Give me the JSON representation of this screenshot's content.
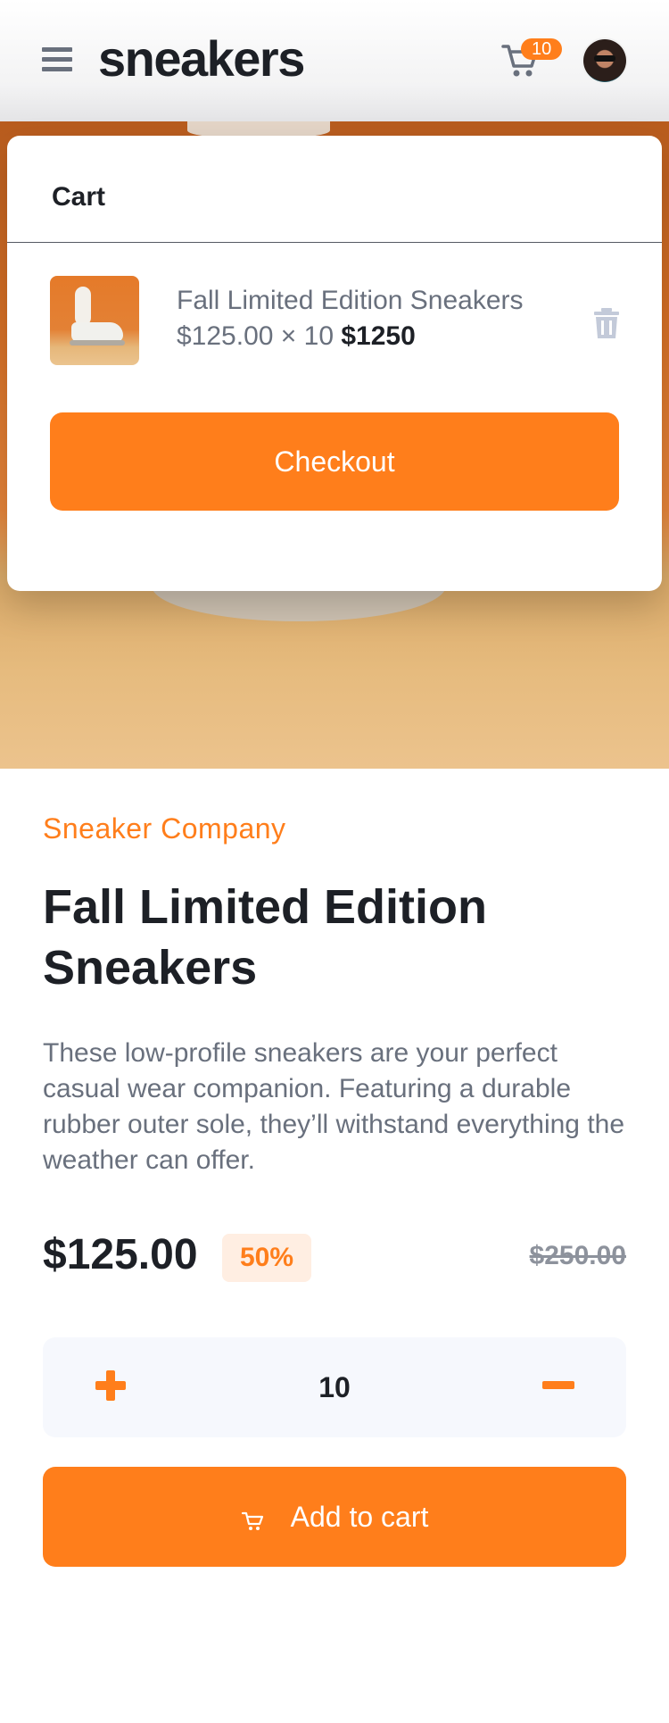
{
  "header": {
    "logo": "sneakers",
    "cart_count": "10"
  },
  "cart": {
    "title": "Cart",
    "item": {
      "name": "Fall Limited Edition Sneakers",
      "unit_price": "$125.00",
      "times": "× 10",
      "total": "$1250"
    },
    "checkout_label": "Checkout"
  },
  "product": {
    "company": "Sneaker Company",
    "title": "Fall Limited Edition Sneakers",
    "description": "These low-profile sneakers are your perfect casual wear companion. Featuring a durable rubber outer sole, they’ll withstand everything the weather can offer.",
    "price": "$125.00",
    "discount": "50%",
    "old_price": "$250.00"
  },
  "quantity": {
    "value": "10"
  },
  "add_to_cart_label": "Add to cart",
  "colors": {
    "accent": "#ff7e1b",
    "accent_pale": "#ffeee2",
    "text_dark": "#1d2026",
    "text_gray": "#69707d",
    "qty_bg": "#f6f8fd"
  },
  "icons": [
    "menu-icon",
    "cart-icon",
    "avatar",
    "trash-icon",
    "plus-icon",
    "minus-icon"
  ]
}
